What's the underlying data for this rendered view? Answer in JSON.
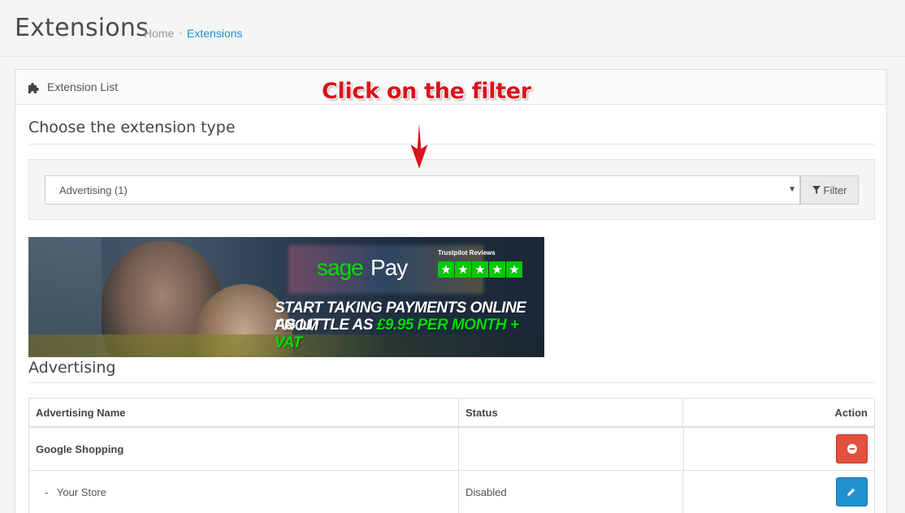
{
  "header": {
    "title": "Extensions",
    "breadcrumb": [
      "Home",
      "Extensions"
    ],
    "breadcrumb_separator": "›"
  },
  "panel": {
    "title": "Extension List",
    "icon": "puzzle-icon"
  },
  "annotation": {
    "text": "Click on the filter",
    "color": "#d9141c"
  },
  "filter": {
    "heading": "Choose the extension type",
    "selected": "Advertising (1)",
    "button_label": "Filter"
  },
  "banner": {
    "brand_sage": "sage",
    "brand_pay": "Pay",
    "trustpilot": "Trustpilot Reviews",
    "line1": "START TAKING PAYMENTS ONLINE FROM",
    "line2_a": "AS LITTLE AS ",
    "line2_b": "£9.95 PER MONTH + VAT",
    "accent": "#00dc00"
  },
  "advertising": {
    "heading": "Advertising",
    "columns": [
      "Advertising Name",
      "Status",
      "Action"
    ],
    "rows": [
      {
        "name": "Google Shopping",
        "status": "",
        "action": "uninstall"
      },
      {
        "name": "-   Your Store",
        "status": "Disabled",
        "action": "edit"
      }
    ]
  },
  "colors": {
    "link": "#1e91cf",
    "danger": "#e3503e",
    "primary": "#1e91cf"
  }
}
